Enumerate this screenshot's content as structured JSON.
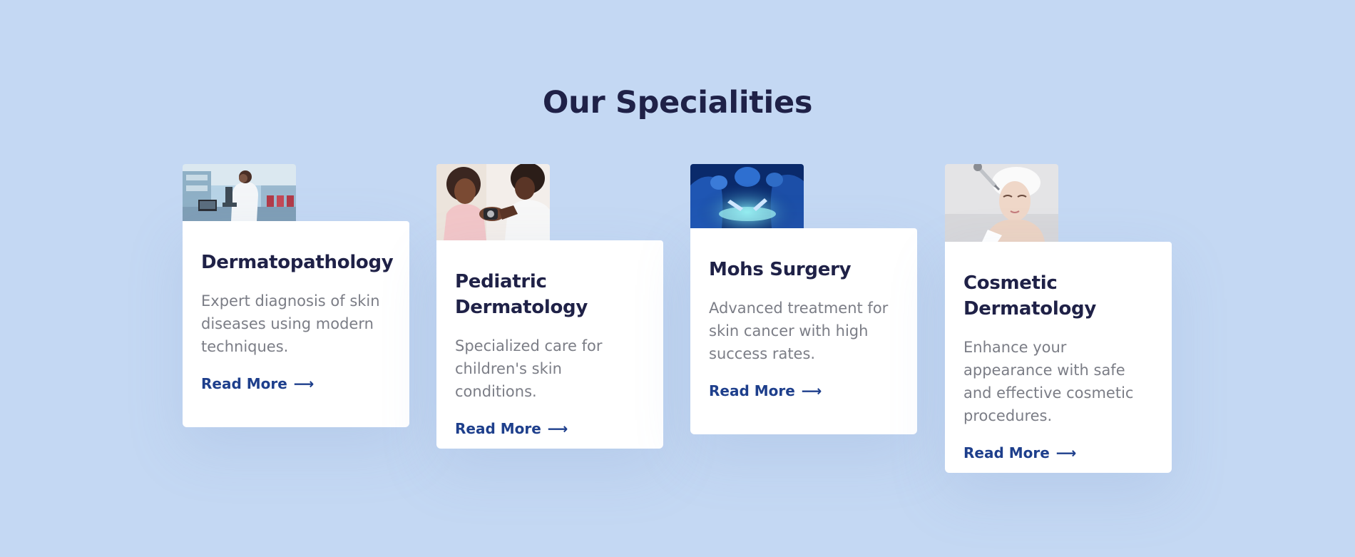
{
  "section": {
    "title": "Our Specialities"
  },
  "cards": [
    {
      "title": "Dermatopathology",
      "description": "Expert diagnosis of skin diseases using modern techniques.",
      "link_label": "Read More",
      "link_icon": "⟶",
      "image": "scientist-microscope-lab-photo"
    },
    {
      "title": "Pediatric Dermatology",
      "description": "Specialized care for children's skin conditions.",
      "link_label": "Read More",
      "link_icon": "⟶",
      "image": "child-doctor-exam-photo"
    },
    {
      "title": "Mohs Surgery",
      "description": "Advanced treatment for skin cancer with high success rates.",
      "link_label": "Read More",
      "link_icon": "⟶",
      "image": "surgeons-operating-room-photo"
    },
    {
      "title": "Cosmetic Dermatology",
      "description": "Enhance your appearance with safe and effective cosmetic procedures.",
      "link_label": "Read More",
      "link_icon": "⟶",
      "image": "woman-facial-treatment-photo"
    }
  ],
  "colors": {
    "background": "#c4d8f3",
    "heading": "#1f2147",
    "body_text": "#7b7d86",
    "link": "#1e3f8c",
    "card": "#ffffff"
  }
}
